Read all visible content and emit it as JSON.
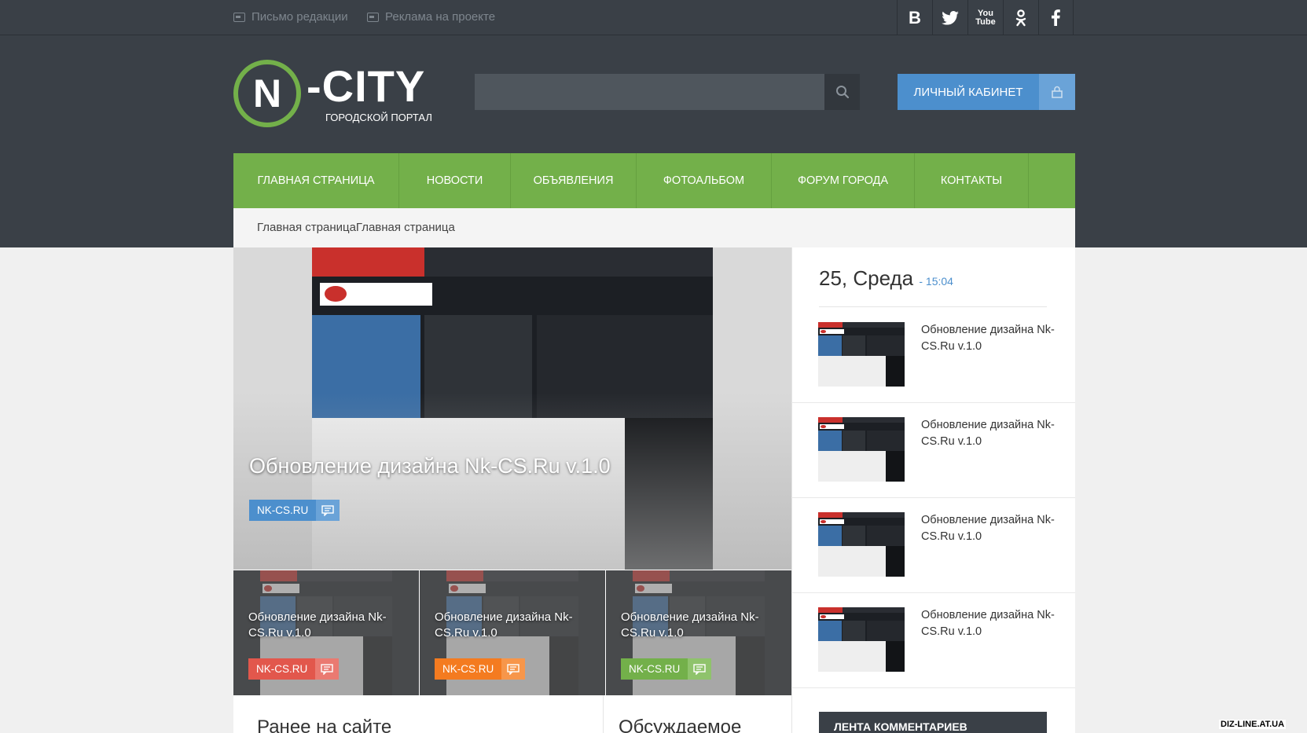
{
  "topbar": {
    "links": [
      "Письмо редакции",
      "Реклама на проекте"
    ],
    "social_icons": [
      "vk-icon",
      "twitter-icon",
      "youtube-icon",
      "odnoklassniki-icon",
      "facebook-icon"
    ],
    "vk_letter": "B",
    "youtube_text": "You Tube"
  },
  "logo": {
    "letter": "N",
    "name": "-CITY",
    "subtitle": "ГОРОДСКОЙ ПОРТАЛ"
  },
  "search": {
    "placeholder": ""
  },
  "cabinet": {
    "label": "ЛИЧНЫЙ КАБИНЕТ"
  },
  "nav": [
    "ГЛАВНАЯ СТРАНИЦА",
    "НОВОСТИ",
    "ОБЪЯВЛЕНИЯ",
    "ФОТОАЛЬБОМ",
    "ФОРУМ ГОРОДА",
    "КОНТАКТЫ"
  ],
  "breadcrumb": "Главная страницаГлавная страница",
  "hero": {
    "title": "Обновление дизайна Nk-CS.Ru v.1.0",
    "tag": "NK-CS.RU"
  },
  "small_cards": [
    {
      "title": "Обновление дизайна Nk-CS.Ru v.1.0",
      "tag": "NK-CS.RU",
      "color": "#e2574c"
    },
    {
      "title": "Обновление дизайна Nk-CS.Ru v.1.0",
      "tag": "NK-CS.RU",
      "color": "#f47b20"
    },
    {
      "title": "Обновление дизайна Nk-CS.Ru v.1.0",
      "tag": "NK-CS.RU",
      "color": "#73b04a"
    }
  ],
  "sections": {
    "earlier": "Ранее на сайте",
    "discussed": "Обсуждаемое"
  },
  "sidebar": {
    "date": "25, Среда",
    "time": "- 15:04",
    "items": [
      "Обновление дизайна Nk-CS.Ru v.1.0",
      "Обновление дизайна Nk-CS.Ru v.1.0",
      "Обновление дизайна Nk-CS.Ru v.1.0",
      "Обновление дизайна Nk-CS.Ru v.1.0"
    ],
    "comments_feed": "ЛЕНТА КОММЕНТАРИЕВ"
  },
  "watermark": "DIZ-LINE.AT.UA",
  "colors": {
    "header": "#3a4047",
    "accent_green": "#73b04a",
    "accent_blue": "#4c8fcd"
  }
}
